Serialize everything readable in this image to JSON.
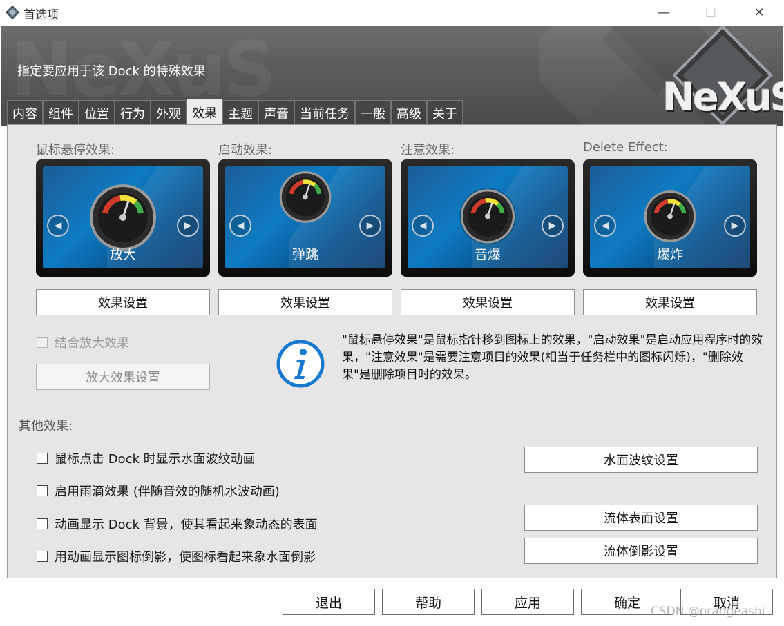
{
  "window": {
    "title": "首选项",
    "minimize_glyph": "—",
    "maximize_glyph": "☐",
    "close_glyph": "✕"
  },
  "banner": {
    "subtitle": "指定要应用于该 Dock 的特殊效果",
    "logo_text": "NeXuS"
  },
  "tabs": [
    {
      "label": "内容"
    },
    {
      "label": "组件"
    },
    {
      "label": "位置"
    },
    {
      "label": "行为"
    },
    {
      "label": "外观"
    },
    {
      "label": "效果",
      "active": true
    },
    {
      "label": "主题"
    },
    {
      "label": "声音"
    },
    {
      "label": "当前任务"
    },
    {
      "label": "一般"
    },
    {
      "label": "高级"
    },
    {
      "label": "关于"
    }
  ],
  "effects": [
    {
      "label": "鼠标悬停效果:",
      "name": "放大",
      "settings_label": "效果设置"
    },
    {
      "label": "启动效果:",
      "name": "弹跳",
      "settings_label": "效果设置"
    },
    {
      "label": "注意效果:",
      "name": "音爆",
      "settings_label": "效果设置"
    },
    {
      "label": "Delete Effect:",
      "name": "爆炸",
      "settings_label": "效果设置"
    }
  ],
  "combine_zoom": {
    "label": "结合放大效果",
    "checked": false,
    "enabled": false
  },
  "zoom_settings_label": "放大效果设置",
  "info_text": "\"鼠标悬停效果\"是鼠标指针移到图标上的效果，\"启动效果\"是启动应用程序时的效果，\"注意效果\"是需要注意项目的效果(相当于任务栏中的图标闪烁)，\"删除效果\"是删除项目时的效果。",
  "other_effects": {
    "title": "其他效果:",
    "options": [
      {
        "label": "鼠标点击 Dock 时显示水面波纹动画",
        "checked": false
      },
      {
        "label": "启用雨滴效果 (伴随音效的随机水波动画)",
        "checked": false
      },
      {
        "label": "动画显示 Dock 背景，使其看起来象动态的表面",
        "checked": false
      },
      {
        "label": "用动画显示图标倒影，使图标看起来象水面倒影",
        "checked": false
      }
    ],
    "ripple_settings_label": "水面波纹设置",
    "fluid_surface_label": "流体表面设置",
    "fluid_reflection_label": "流体倒影设置"
  },
  "footer": {
    "exit_label": "退出",
    "help_label": "帮助",
    "apply_label": "应用",
    "ok_label": "确定",
    "cancel_label": "取消"
  },
  "watermark": "CSDN @orangeashi",
  "colors": {
    "accent_blue": "#1779d0",
    "screen_blue": "#0e7bc2",
    "banner_gray": "#5b5b5b"
  }
}
